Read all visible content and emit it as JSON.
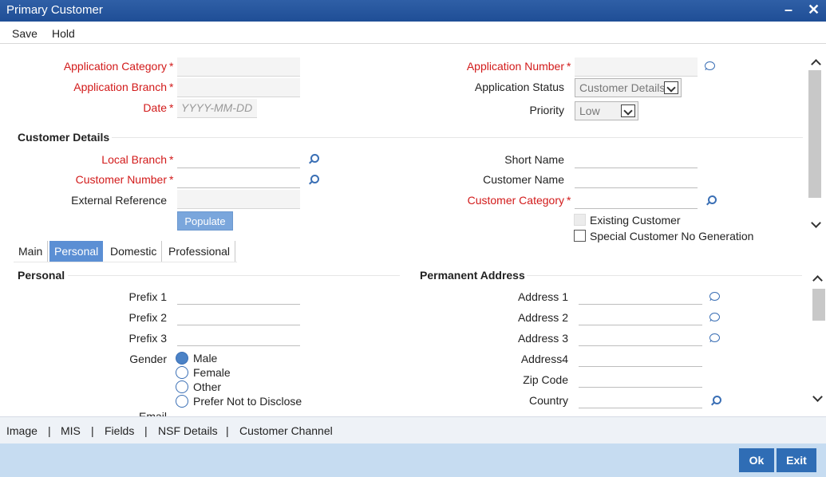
{
  "window": {
    "title": "Primary Customer",
    "minimize": "–",
    "close": "✕"
  },
  "menu": {
    "save": "Save",
    "hold": "Hold"
  },
  "header": {
    "app_category_label": "Application Category",
    "app_branch_label": "Application Branch",
    "date_label": "Date",
    "date_placeholder": "YYYY-MM-DD",
    "app_number_label": "Application Number",
    "app_status_label": "Application Status",
    "app_status_value": "Customer Details",
    "priority_label": "Priority",
    "priority_value": "Low",
    "required_mark": "*"
  },
  "customer_details": {
    "title": "Customer Details",
    "local_branch_label": "Local Branch",
    "customer_number_label": "Customer Number",
    "external_reference_label": "External Reference",
    "populate_label": "Populate",
    "short_name_label": "Short Name",
    "customer_name_label": "Customer Name",
    "customer_category_label": "Customer Category",
    "existing_customer_label": "Existing Customer",
    "special_no_label": "Special Customer No Generation"
  },
  "tabs": [
    "Main",
    "Personal",
    "Domestic",
    "Professional"
  ],
  "personal": {
    "title": "Personal",
    "prefix1_label": "Prefix 1",
    "prefix2_label": "Prefix 2",
    "prefix3_label": "Prefix 3",
    "gender_label": "Gender",
    "gender_options": [
      "Male",
      "Female",
      "Other",
      "Prefer Not to Disclose"
    ],
    "email_label": "Email"
  },
  "permanent_address": {
    "title": "Permanent Address",
    "address1_label": "Address 1",
    "address2_label": "Address 2",
    "address3_label": "Address 3",
    "address4_label": "Address4",
    "zip_label": "Zip Code",
    "country_label": "Country"
  },
  "bottom_links": [
    "Image",
    "MIS",
    "Fields",
    "NSF Details",
    "Customer Channel"
  ],
  "bottom_sep": "|",
  "footer": {
    "ok": "Ok",
    "exit": "Exit"
  }
}
